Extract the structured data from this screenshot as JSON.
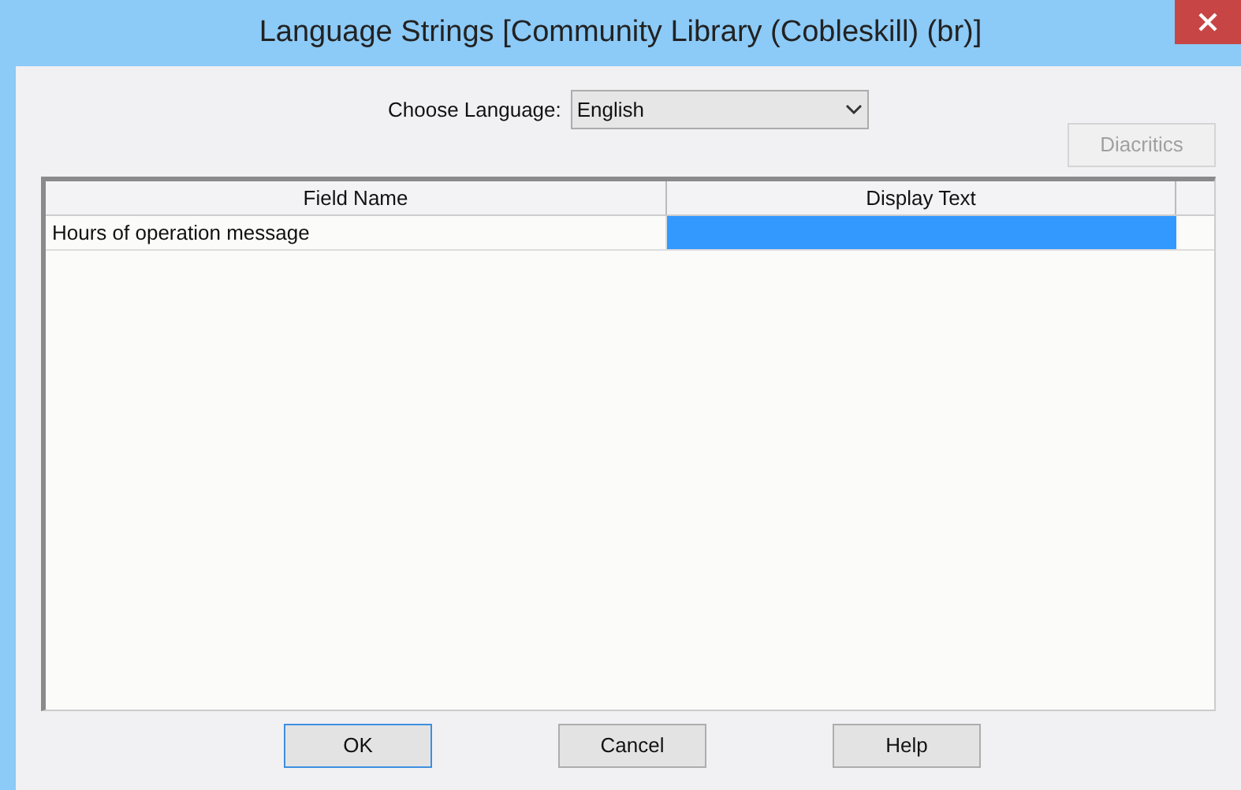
{
  "window": {
    "title": "Language Strings [Community Library (Cobleskill) (br)]"
  },
  "language": {
    "label": "Choose Language:",
    "value": "English"
  },
  "diacritics_button": {
    "label": "Diacritics",
    "disabled": true
  },
  "table": {
    "columns": [
      "Field Name",
      "Display Text"
    ],
    "rows": [
      {
        "field_name": "Hours of operation message",
        "selected": true
      }
    ]
  },
  "buttons": [
    {
      "label": "OK",
      "default": true
    },
    {
      "label": "Cancel",
      "default": false
    },
    {
      "label": "Help",
      "default": false
    }
  ]
}
